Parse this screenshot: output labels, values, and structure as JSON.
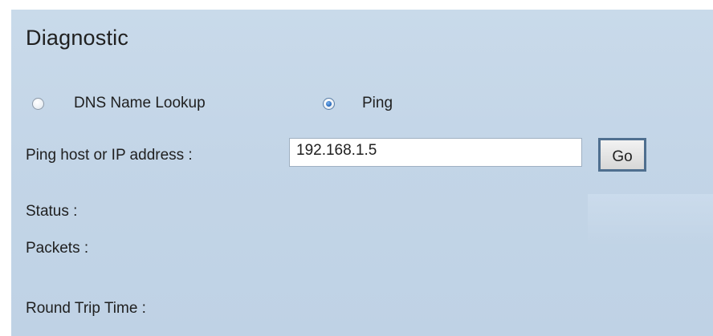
{
  "section": {
    "title": "Diagnostic"
  },
  "mode": {
    "options": [
      {
        "label": "DNS Name Lookup",
        "selected": false
      },
      {
        "label": "Ping",
        "selected": true
      }
    ]
  },
  "ping": {
    "host_label": "Ping host or IP address :",
    "host_value": "192.168.1.5",
    "go_label": "Go"
  },
  "results": {
    "status_label": "Status :",
    "packets_label": "Packets :",
    "rtt_label": "Round Trip Time :"
  },
  "colors": {
    "panel_background": "#c5d7e8",
    "button_border": "#4f6f8f",
    "radio_selected": "#2f6fbf"
  }
}
